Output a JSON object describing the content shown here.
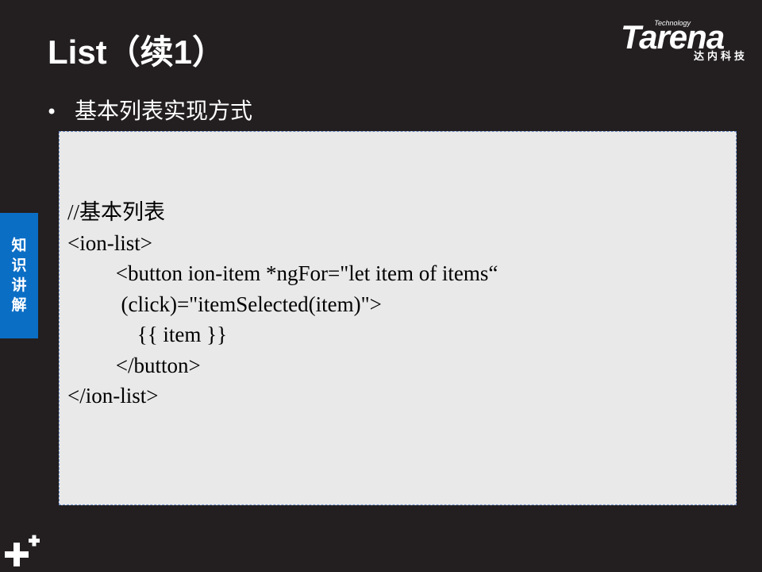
{
  "slide": {
    "title": "List（续1）",
    "bullet": "基本列表实现方式"
  },
  "logo": {
    "technology": "Technology",
    "wordmark": "Tarena",
    "chinese": "达内科技"
  },
  "side_tab": {
    "chars": [
      "知",
      "识",
      "讲",
      "解"
    ]
  },
  "code": {
    "lines": [
      "//基本列表",
      "<ion-list>",
      "         <button ion-item *ngFor=\"let item of items“",
      "          (click)=\"itemSelected(item)\">",
      "             {{ item }}",
      "         </button>",
      "</ion-list>"
    ]
  },
  "colors": {
    "background": "#231f20",
    "tab_blue": "#0b6ec5",
    "code_box_bg": "#e9e9e9",
    "code_box_border": "#6b8cc8"
  },
  "icons": {
    "corner": "plus-icon"
  }
}
